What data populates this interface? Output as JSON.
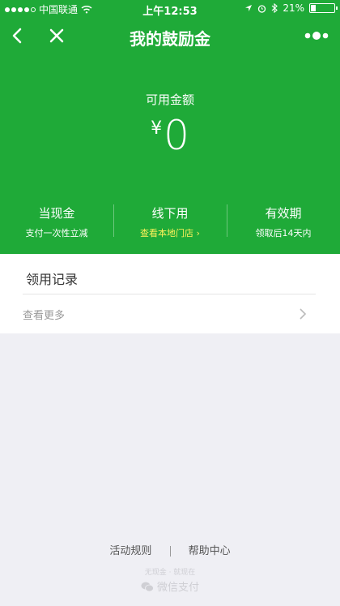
{
  "status_bar": {
    "carrier": "中国联通",
    "time": "上午12:53",
    "battery": "21%"
  },
  "nav": {
    "title": "我的鼓励金"
  },
  "balance": {
    "label": "可用金额",
    "currency": "¥",
    "amount": "0"
  },
  "features": [
    {
      "title": "当现金",
      "sub": "支付一次性立减"
    },
    {
      "title": "线下用",
      "sub": "查看本地门店 ›"
    },
    {
      "title": "有效期",
      "sub": "领取后14天内"
    }
  ],
  "records": {
    "header": "领用记录",
    "more": "查看更多"
  },
  "footer": {
    "rules": "活动规则",
    "help": "帮助中心",
    "slogan": "无现金 · 就现在",
    "brand": "微信支付"
  },
  "colors": {
    "primary_green": "#1faa38",
    "link_yellow": "#fff25a",
    "background": "#efeff4"
  }
}
